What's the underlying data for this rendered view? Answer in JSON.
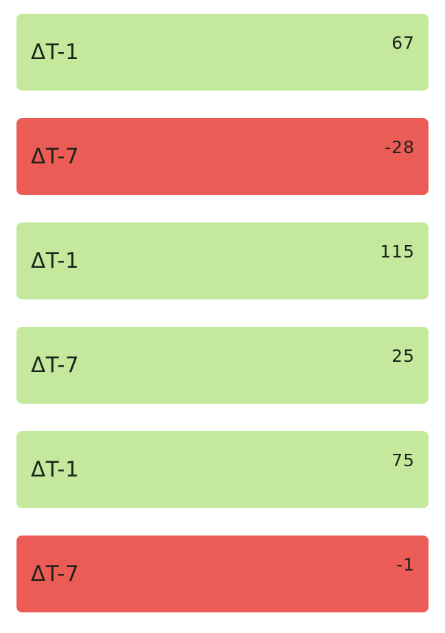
{
  "colors": {
    "positive": "#c4e99c",
    "negative": "#ec5c56"
  },
  "cards": [
    {
      "label": "ΔT-1",
      "value": "67",
      "status": "positive"
    },
    {
      "label": "ΔT-7",
      "value": "-28",
      "status": "negative"
    },
    {
      "label": "ΔT-1",
      "value": "115",
      "status": "positive"
    },
    {
      "label": "ΔT-7",
      "value": "25",
      "status": "positive"
    },
    {
      "label": "ΔT-1",
      "value": "75",
      "status": "positive"
    },
    {
      "label": "ΔT-7",
      "value": "-1",
      "status": "negative"
    }
  ]
}
